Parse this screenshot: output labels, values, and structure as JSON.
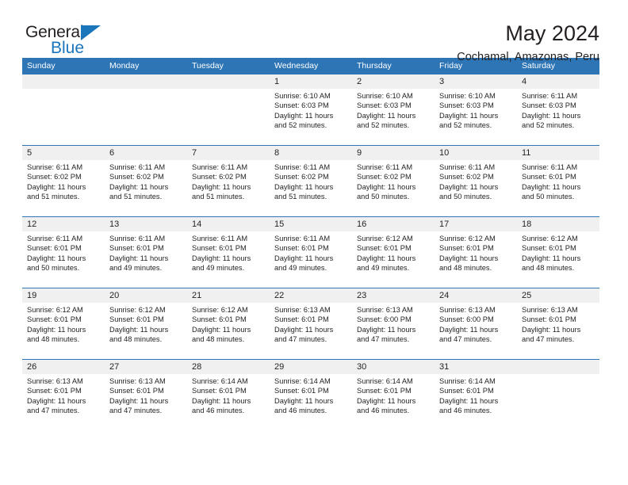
{
  "brand": {
    "name_part1": "General",
    "name_part2": "Blue",
    "triangle_color": "#1b75bb",
    "text_color": "#231f20"
  },
  "header": {
    "title": "May 2024",
    "subtitle": "Cochamal, Amazonas, Peru"
  },
  "theme": {
    "header_band": "#2e75b6",
    "date_band": "#f0f0f0",
    "text": "#231f20",
    "cell_background": "#ffffff"
  },
  "calendar": {
    "weekdays": [
      "Sunday",
      "Monday",
      "Tuesday",
      "Wednesday",
      "Thursday",
      "Friday",
      "Saturday"
    ],
    "weeks": [
      [
        {
          "day": "",
          "sunrise": "",
          "sunset": "",
          "daylight_1": "",
          "daylight_2": ""
        },
        {
          "day": "",
          "sunrise": "",
          "sunset": "",
          "daylight_1": "",
          "daylight_2": ""
        },
        {
          "day": "",
          "sunrise": "",
          "sunset": "",
          "daylight_1": "",
          "daylight_2": ""
        },
        {
          "day": "1",
          "sunrise": "Sunrise: 6:10 AM",
          "sunset": "Sunset: 6:03 PM",
          "daylight_1": "Daylight: 11 hours",
          "daylight_2": "and 52 minutes."
        },
        {
          "day": "2",
          "sunrise": "Sunrise: 6:10 AM",
          "sunset": "Sunset: 6:03 PM",
          "daylight_1": "Daylight: 11 hours",
          "daylight_2": "and 52 minutes."
        },
        {
          "day": "3",
          "sunrise": "Sunrise: 6:10 AM",
          "sunset": "Sunset: 6:03 PM",
          "daylight_1": "Daylight: 11 hours",
          "daylight_2": "and 52 minutes."
        },
        {
          "day": "4",
          "sunrise": "Sunrise: 6:11 AM",
          "sunset": "Sunset: 6:03 PM",
          "daylight_1": "Daylight: 11 hours",
          "daylight_2": "and 52 minutes."
        }
      ],
      [
        {
          "day": "5",
          "sunrise": "Sunrise: 6:11 AM",
          "sunset": "Sunset: 6:02 PM",
          "daylight_1": "Daylight: 11 hours",
          "daylight_2": "and 51 minutes."
        },
        {
          "day": "6",
          "sunrise": "Sunrise: 6:11 AM",
          "sunset": "Sunset: 6:02 PM",
          "daylight_1": "Daylight: 11 hours",
          "daylight_2": "and 51 minutes."
        },
        {
          "day": "7",
          "sunrise": "Sunrise: 6:11 AM",
          "sunset": "Sunset: 6:02 PM",
          "daylight_1": "Daylight: 11 hours",
          "daylight_2": "and 51 minutes."
        },
        {
          "day": "8",
          "sunrise": "Sunrise: 6:11 AM",
          "sunset": "Sunset: 6:02 PM",
          "daylight_1": "Daylight: 11 hours",
          "daylight_2": "and 51 minutes."
        },
        {
          "day": "9",
          "sunrise": "Sunrise: 6:11 AM",
          "sunset": "Sunset: 6:02 PM",
          "daylight_1": "Daylight: 11 hours",
          "daylight_2": "and 50 minutes."
        },
        {
          "day": "10",
          "sunrise": "Sunrise: 6:11 AM",
          "sunset": "Sunset: 6:02 PM",
          "daylight_1": "Daylight: 11 hours",
          "daylight_2": "and 50 minutes."
        },
        {
          "day": "11",
          "sunrise": "Sunrise: 6:11 AM",
          "sunset": "Sunset: 6:01 PM",
          "daylight_1": "Daylight: 11 hours",
          "daylight_2": "and 50 minutes."
        }
      ],
      [
        {
          "day": "12",
          "sunrise": "Sunrise: 6:11 AM",
          "sunset": "Sunset: 6:01 PM",
          "daylight_1": "Daylight: 11 hours",
          "daylight_2": "and 50 minutes."
        },
        {
          "day": "13",
          "sunrise": "Sunrise: 6:11 AM",
          "sunset": "Sunset: 6:01 PM",
          "daylight_1": "Daylight: 11 hours",
          "daylight_2": "and 49 minutes."
        },
        {
          "day": "14",
          "sunrise": "Sunrise: 6:11 AM",
          "sunset": "Sunset: 6:01 PM",
          "daylight_1": "Daylight: 11 hours",
          "daylight_2": "and 49 minutes."
        },
        {
          "day": "15",
          "sunrise": "Sunrise: 6:11 AM",
          "sunset": "Sunset: 6:01 PM",
          "daylight_1": "Daylight: 11 hours",
          "daylight_2": "and 49 minutes."
        },
        {
          "day": "16",
          "sunrise": "Sunrise: 6:12 AM",
          "sunset": "Sunset: 6:01 PM",
          "daylight_1": "Daylight: 11 hours",
          "daylight_2": "and 49 minutes."
        },
        {
          "day": "17",
          "sunrise": "Sunrise: 6:12 AM",
          "sunset": "Sunset: 6:01 PM",
          "daylight_1": "Daylight: 11 hours",
          "daylight_2": "and 48 minutes."
        },
        {
          "day": "18",
          "sunrise": "Sunrise: 6:12 AM",
          "sunset": "Sunset: 6:01 PM",
          "daylight_1": "Daylight: 11 hours",
          "daylight_2": "and 48 minutes."
        }
      ],
      [
        {
          "day": "19",
          "sunrise": "Sunrise: 6:12 AM",
          "sunset": "Sunset: 6:01 PM",
          "daylight_1": "Daylight: 11 hours",
          "daylight_2": "and 48 minutes."
        },
        {
          "day": "20",
          "sunrise": "Sunrise: 6:12 AM",
          "sunset": "Sunset: 6:01 PM",
          "daylight_1": "Daylight: 11 hours",
          "daylight_2": "and 48 minutes."
        },
        {
          "day": "21",
          "sunrise": "Sunrise: 6:12 AM",
          "sunset": "Sunset: 6:01 PM",
          "daylight_1": "Daylight: 11 hours",
          "daylight_2": "and 48 minutes."
        },
        {
          "day": "22",
          "sunrise": "Sunrise: 6:13 AM",
          "sunset": "Sunset: 6:01 PM",
          "daylight_1": "Daylight: 11 hours",
          "daylight_2": "and 47 minutes."
        },
        {
          "day": "23",
          "sunrise": "Sunrise: 6:13 AM",
          "sunset": "Sunset: 6:00 PM",
          "daylight_1": "Daylight: 11 hours",
          "daylight_2": "and 47 minutes."
        },
        {
          "day": "24",
          "sunrise": "Sunrise: 6:13 AM",
          "sunset": "Sunset: 6:00 PM",
          "daylight_1": "Daylight: 11 hours",
          "daylight_2": "and 47 minutes."
        },
        {
          "day": "25",
          "sunrise": "Sunrise: 6:13 AM",
          "sunset": "Sunset: 6:01 PM",
          "daylight_1": "Daylight: 11 hours",
          "daylight_2": "and 47 minutes."
        }
      ],
      [
        {
          "day": "26",
          "sunrise": "Sunrise: 6:13 AM",
          "sunset": "Sunset: 6:01 PM",
          "daylight_1": "Daylight: 11 hours",
          "daylight_2": "and 47 minutes."
        },
        {
          "day": "27",
          "sunrise": "Sunrise: 6:13 AM",
          "sunset": "Sunset: 6:01 PM",
          "daylight_1": "Daylight: 11 hours",
          "daylight_2": "and 47 minutes."
        },
        {
          "day": "28",
          "sunrise": "Sunrise: 6:14 AM",
          "sunset": "Sunset: 6:01 PM",
          "daylight_1": "Daylight: 11 hours",
          "daylight_2": "and 46 minutes."
        },
        {
          "day": "29",
          "sunrise": "Sunrise: 6:14 AM",
          "sunset": "Sunset: 6:01 PM",
          "daylight_1": "Daylight: 11 hours",
          "daylight_2": "and 46 minutes."
        },
        {
          "day": "30",
          "sunrise": "Sunrise: 6:14 AM",
          "sunset": "Sunset: 6:01 PM",
          "daylight_1": "Daylight: 11 hours",
          "daylight_2": "and 46 minutes."
        },
        {
          "day": "31",
          "sunrise": "Sunrise: 6:14 AM",
          "sunset": "Sunset: 6:01 PM",
          "daylight_1": "Daylight: 11 hours",
          "daylight_2": "and 46 minutes."
        },
        {
          "day": "",
          "sunrise": "",
          "sunset": "",
          "daylight_1": "",
          "daylight_2": ""
        }
      ]
    ]
  }
}
